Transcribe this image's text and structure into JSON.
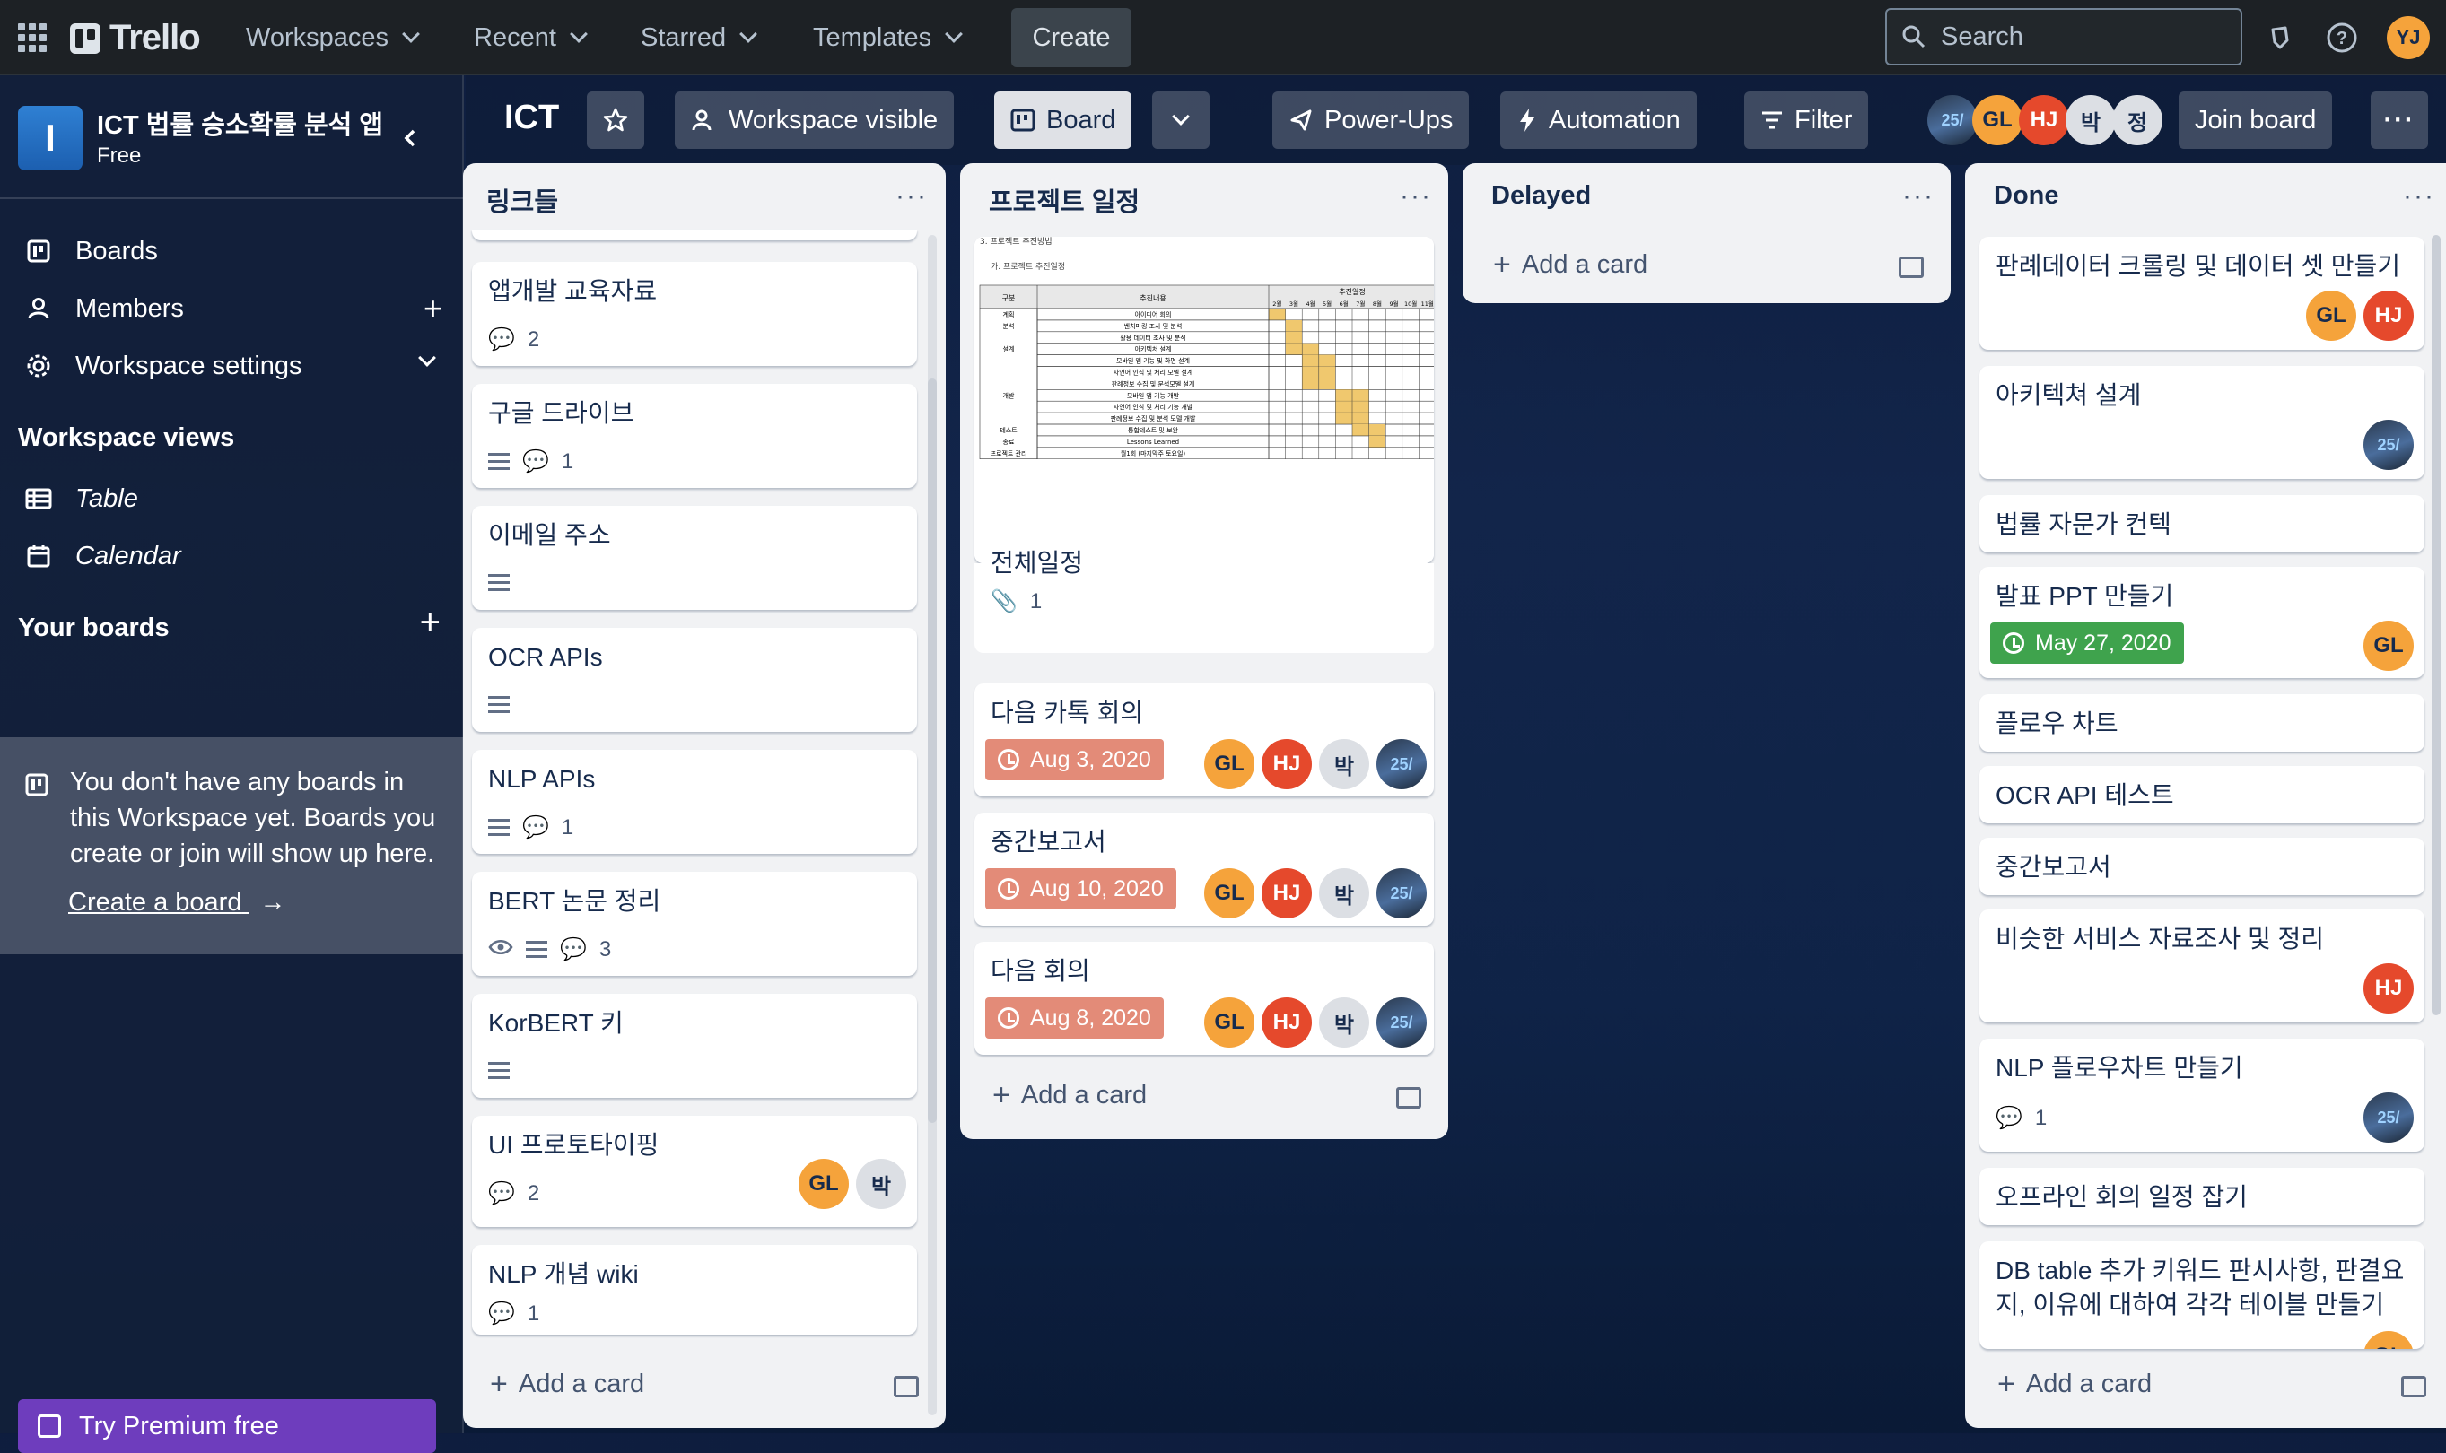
{
  "topnav": {
    "brand": "Trello",
    "menus": [
      "Workspaces",
      "Recent",
      "Starred",
      "Templates"
    ],
    "create_label": "Create",
    "search_placeholder": "Search",
    "user_initials": "YJ",
    "icons": [
      "apps-grid-icon",
      "notifications-icon",
      "help-icon"
    ]
  },
  "sidebar": {
    "workspace_initial": "I",
    "workspace_name": "ICT 법률 승소확률 분석 앱",
    "workspace_plan": "Free",
    "items": [
      {
        "label": "Boards",
        "icon": "board-icon"
      },
      {
        "label": "Members",
        "icon": "person-icon"
      },
      {
        "label": "Workspace settings",
        "icon": "gear-icon"
      }
    ],
    "views_heading": "Workspace views",
    "views": [
      {
        "label": "Table",
        "icon": "table-icon"
      },
      {
        "label": "Calendar",
        "icon": "calendar-icon"
      }
    ],
    "your_boards_heading": "Your boards",
    "empty_text": "You don't have any boards in this Workspace yet. Boards you create or join will show up here.",
    "create_board_link": "Create a board",
    "premium_label": "Try Premium free"
  },
  "board_header": {
    "title": "ICT",
    "visibility_label": "Workspace visible",
    "view_label": "Board",
    "powerups_label": "Power-Ups",
    "automation_label": "Automation",
    "filter_label": "Filter",
    "members": [
      "GL",
      "HJ",
      "박",
      "정"
    ],
    "join_label": "Join board"
  },
  "lists": [
    {
      "title": "링크들",
      "add_label": "Add a card",
      "cards": [
        {
          "title": "앱개발 교육자료",
          "comments": "2"
        },
        {
          "title": "구글 드라이브",
          "comments": "1"
        },
        {
          "title": "이메일 주소"
        },
        {
          "title": "OCR APIs"
        },
        {
          "title": "NLP APIs",
          "comments": "1"
        },
        {
          "title": "BERT 논문 정리",
          "comments": "3"
        },
        {
          "title": "KorBERT 키"
        },
        {
          "title": "UI 프로토타이핑",
          "comments": "2",
          "members": [
            "GL",
            "박"
          ]
        },
        {
          "title": "NLP 개념 wiki",
          "comments": "1"
        }
      ]
    },
    {
      "title": "프로젝트 일정",
      "add_label": "Add a card",
      "cards": [
        {
          "title": "전체일정",
          "attachments": "1",
          "cover": {
            "heading": "3. 프로젝트 추진방법",
            "sub": "가. 프로젝트 추진일정",
            "col_group": "구분",
            "col_content": "추진내용",
            "col_schedule": "추진일정",
            "months": [
              "2월",
              "3월",
              "4월",
              "5월",
              "6월",
              "7월",
              "8월",
              "9월",
              "10월",
              "11월"
            ],
            "rows": [
              {
                "group": "계획",
                "task": "아이디어 회의"
              },
              {
                "group": "분석",
                "task": "벤치마킹 조사 및 분석"
              },
              {
                "group": "",
                "task": "활용 데이터 조사 및 분석"
              },
              {
                "group": "설계",
                "task": "아키텍처 설계"
              },
              {
                "group": "",
                "task": "모바일 앱 기능 및 화면 설계"
              },
              {
                "group": "",
                "task": "자연어 인식 및 처리 모델 설계"
              },
              {
                "group": "",
                "task": "판례정보 수집 및 분석모델 설계"
              },
              {
                "group": "개발",
                "task": "모바일 앱 기능 개발"
              },
              {
                "group": "",
                "task": "자연어 인식 및 처리 기능 개발"
              },
              {
                "group": "",
                "task": "판례정보 수집 및 분석 모델 개발"
              },
              {
                "group": "테스트",
                "task": "통합테스트 및 보완"
              },
              {
                "group": "종료",
                "task": "Lessons Learned"
              },
              {
                "group": "프로젝트 관리",
                "task": "월1회 (마지막주 토요일)"
              }
            ]
          }
        },
        {
          "title": "다음 카톡 회의",
          "due": "Aug 3, 2020",
          "members": [
            "GL",
            "HJ",
            "박",
            "photo"
          ]
        },
        {
          "title": "중간보고서",
          "due": "Aug 10, 2020",
          "members": [
            "GL",
            "HJ",
            "박",
            "photo"
          ]
        },
        {
          "title": "다음 회의",
          "due": "Aug 8, 2020",
          "members": [
            "GL",
            "HJ",
            "박",
            "photo"
          ]
        }
      ]
    },
    {
      "title": "Delayed",
      "add_label": "Add a card",
      "cards": []
    },
    {
      "title": "Done",
      "add_label": "Add a card",
      "cards": [
        {
          "title": "판례데이터 크롤링 및 데이터 셋 만들기",
          "members": [
            "GL",
            "HJ"
          ]
        },
        {
          "title": "아키텍쳐 설계",
          "members": [
            "photo"
          ]
        },
        {
          "title": "법률 자문가 컨텍"
        },
        {
          "title": "발표 PPT 만들기",
          "due": "May 27, 2020",
          "members": [
            "GL"
          ]
        },
        {
          "title": "플로우 차트"
        },
        {
          "title": "OCR API 테스트"
        },
        {
          "title": "중간보고서"
        },
        {
          "title": "비슷한 서비스 자료조사 및 정리",
          "members": [
            "HJ"
          ]
        },
        {
          "title": "NLP 플로우차트 만들기",
          "comments": "1",
          "members": [
            "photo"
          ]
        },
        {
          "title": "오프라인 회의 일정 잡기"
        },
        {
          "title": "DB table 추가 키워드 판시사항, 판결요지, 이유에 대하여 각각 테이블 만들기",
          "members": [
            "GL"
          ]
        }
      ]
    }
  ],
  "colors": {
    "nav_bg": "#1d2125",
    "list_bg": "#f1f2f4",
    "due_overdue": "#e38b78",
    "due_complete": "#3fa34d",
    "avatar_gl": "#f5a33b",
    "avatar_hj": "#e5492c",
    "premium": "#6e3dbd",
    "chart_fill": "#f0c86e"
  }
}
